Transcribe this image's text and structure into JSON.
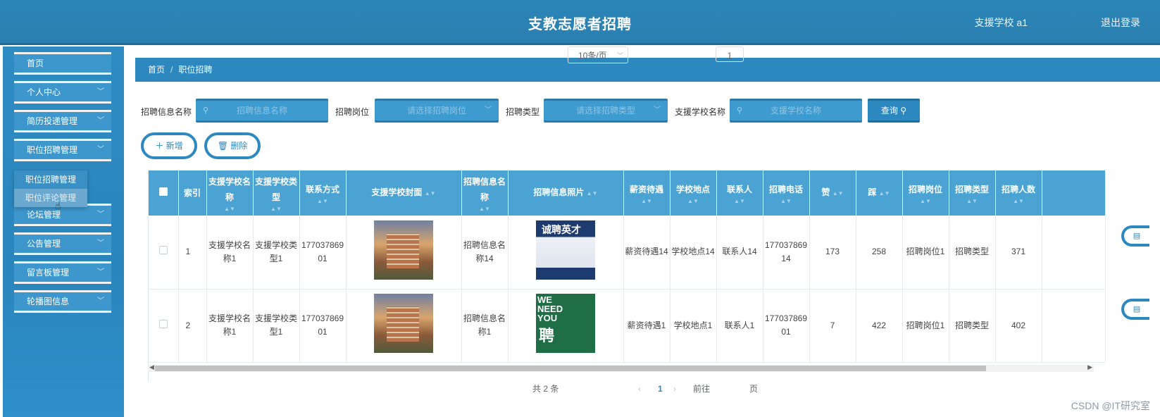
{
  "header": {
    "title": "支教志愿者招聘",
    "user": "支援学校 a1",
    "logout": "退出登录"
  },
  "sidebar": {
    "items": [
      {
        "label": "首页"
      },
      {
        "label": "个人中心"
      },
      {
        "label": "简历投递管理"
      },
      {
        "label": "职位招聘管理"
      },
      {
        "label": "论坛管理"
      },
      {
        "label": "公告管理"
      },
      {
        "label": "留言板管理"
      },
      {
        "label": "轮播图信息"
      }
    ],
    "submenu": [
      "职位招聘管理",
      "职位评论管理"
    ]
  },
  "breadcrumb": {
    "home": "首页",
    "current": "职位招聘"
  },
  "search": {
    "label1": "招聘信息名称",
    "placeholder1": "招聘信息名称",
    "label2": "招聘岗位",
    "placeholder2": "请选择招聘岗位",
    "label3": "招聘类型",
    "placeholder3": "请选择招聘类型",
    "label4": "支援学校名称",
    "placeholder4": "支援学校名称",
    "query": "查询"
  },
  "actions": {
    "add": "新增",
    "delete": "删除"
  },
  "table": {
    "headers": [
      "索引",
      "支援学校名称",
      "支援学校类型",
      "联系方式",
      "支援学校封面",
      "招聘信息名称",
      "招聘信息照片",
      "薪资待遇",
      "学校地点",
      "联系人",
      "招聘电话",
      "赞",
      "踩",
      "招聘岗位",
      "招聘类型",
      "招聘人数"
    ],
    "rows": [
      {
        "index": "1",
        "school": "支援学校名称1",
        "type": "支援学校类型1",
        "contact": "17703786901",
        "info": "招聘信息名称14",
        "salary": "薪资待遇14",
        "location": "学校地点14",
        "person": "联系人14",
        "phone": "17703786914",
        "like": "173",
        "dislike": "258",
        "post": "招聘岗位1",
        "rtype": "招聘类型",
        "num": "371"
      },
      {
        "index": "2",
        "school": "支援学校名称1",
        "type": "支援学校类型1",
        "contact": "17703786901",
        "info": "招聘信息名称1",
        "salary": "薪资待遇1",
        "location": "学校地点1",
        "person": "联系人1",
        "phone": "17703786901",
        "like": "7",
        "dislike": "422",
        "post": "招聘岗位1",
        "rtype": "招聘类型",
        "num": "402"
      }
    ]
  },
  "pager": {
    "total": "共 2 条",
    "size": "10条/页",
    "page": "1",
    "goto": "前往",
    "goto_val": "1",
    "page_unit": "页"
  },
  "watermark": "CSDN @IT研究室"
}
